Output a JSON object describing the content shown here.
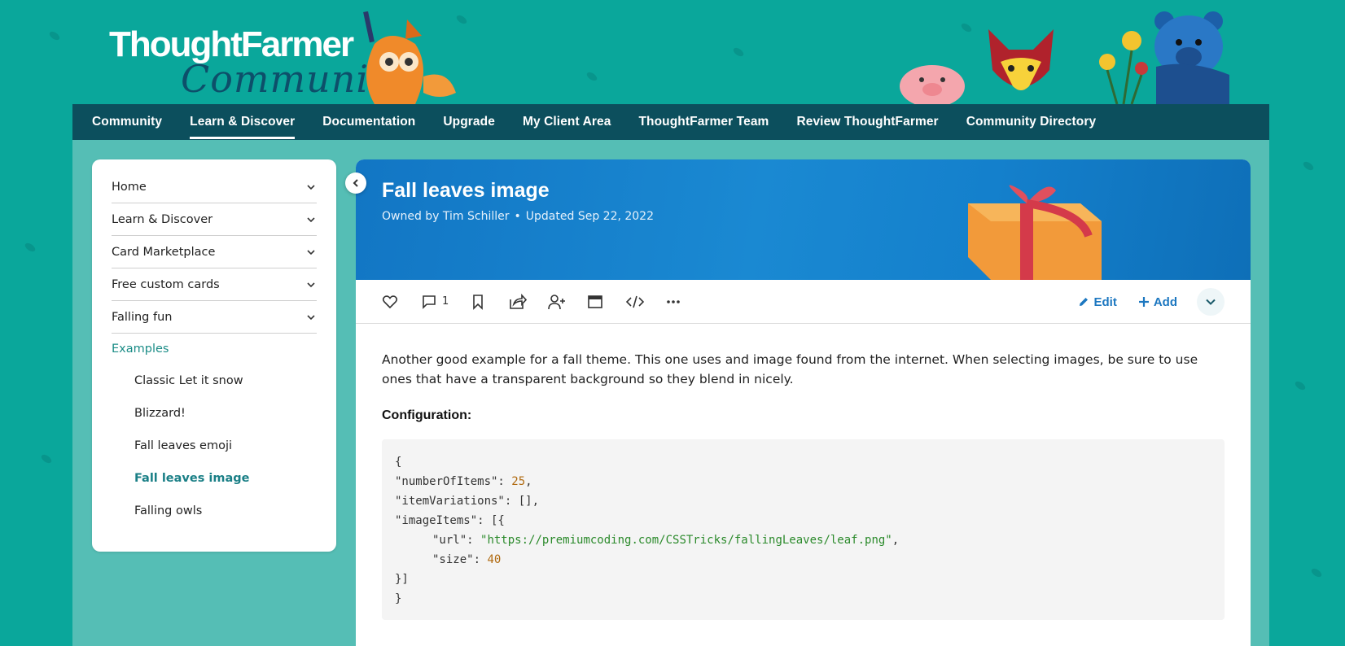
{
  "header": {
    "logo_main": "ThoughtFarmer",
    "logo_sub": "Community"
  },
  "nav": {
    "items": [
      {
        "label": "Community",
        "active": false
      },
      {
        "label": "Learn & Discover",
        "active": true
      },
      {
        "label": "Documentation",
        "active": false
      },
      {
        "label": "Upgrade",
        "active": false
      },
      {
        "label": "My Client Area",
        "active": false
      },
      {
        "label": "ThoughtFarmer Team",
        "active": false
      },
      {
        "label": "Review ThoughtFarmer",
        "active": false
      },
      {
        "label": "Community Directory",
        "active": false
      }
    ]
  },
  "sidebar": {
    "items": [
      {
        "label": "Home"
      },
      {
        "label": "Learn & Discover"
      },
      {
        "label": "Card Marketplace"
      },
      {
        "label": "Free custom cards"
      },
      {
        "label": "Falling fun"
      }
    ],
    "section": "Examples",
    "subitems": [
      {
        "label": "Classic Let it snow",
        "active": false
      },
      {
        "label": "Blizzard!",
        "active": false
      },
      {
        "label": "Fall leaves emoji",
        "active": false
      },
      {
        "label": "Fall leaves image",
        "active": true
      },
      {
        "label": "Falling owls",
        "active": false
      }
    ]
  },
  "page": {
    "title": "Fall leaves image",
    "owner": "Owned by Tim Schiller",
    "updated": "Updated Sep 22, 2022",
    "separator": "•"
  },
  "toolbar": {
    "comment_count": "1",
    "edit_label": "Edit",
    "add_label": "Add",
    "icons": [
      "heart-icon",
      "comment-icon",
      "bookmark-icon",
      "share-icon",
      "add-user-icon",
      "window-icon",
      "code-icon",
      "more-icon"
    ]
  },
  "body": {
    "intro": "Another good example for a fall theme. This one uses and image found from the internet. When selecting images, be sure to use ones that have a transparent background so they blend in nicely.",
    "config_label": "Configuration:",
    "code": {
      "open": "{",
      "k1": "\"numberOfItems\": ",
      "v1": "25",
      "k2": "\"itemVariations\": [],",
      "k3": "\"imageItems\": [{",
      "k4": "\"url\": ",
      "v4": "\"https://premiumcoding.com/CSSTricks/fallingLeaves/leaf.png\"",
      "k5": "\"size\": ",
      "v5": "40",
      "close_arr": "}]",
      "close": "}"
    }
  },
  "colors": {
    "background": "#0aa79b",
    "nav": "#0c4f5d",
    "content_bg": "#55beb5",
    "banner": "#1a89d2",
    "accent_link": "#1c77c0",
    "sidebar_active": "#1a7f86"
  }
}
